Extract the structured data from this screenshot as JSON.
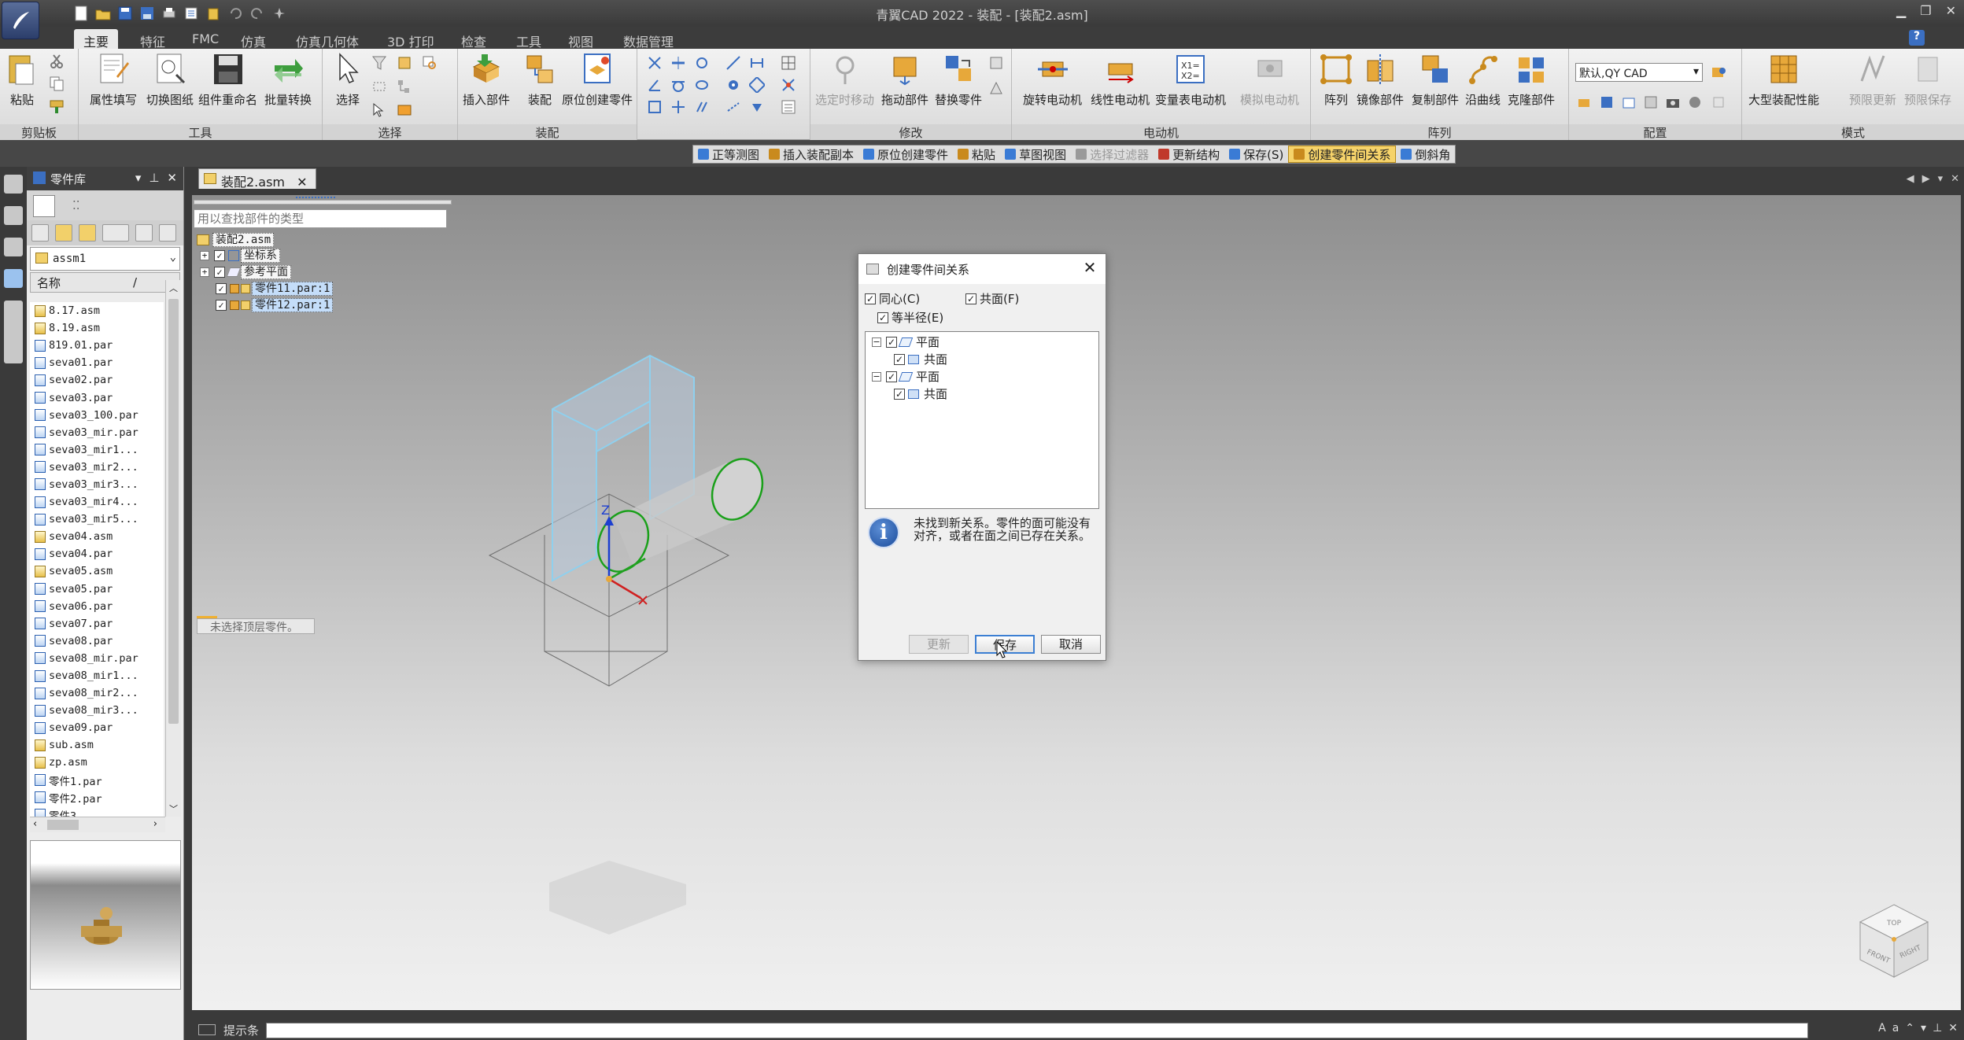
{
  "window": {
    "title": "青翼CAD 2022 - 装配 - [装配2.asm]",
    "help": "?"
  },
  "ribbon_tabs": [
    "主要",
    "特征",
    "FMC",
    "仿真",
    "仿真几何体",
    "3D 打印",
    "检查",
    "工具",
    "视图",
    "数据管理"
  ],
  "ribbon": {
    "clipboard": {
      "label": "剪贴板",
      "paste": "粘贴"
    },
    "tools": {
      "label": "工具",
      "prop_fill": "属性填写",
      "switch_drawing": "切换图纸",
      "rename": "组件重命名",
      "batch_convert": "批量转换"
    },
    "select": {
      "label": "选择",
      "select": "选择"
    },
    "assemble": {
      "label": "装配",
      "insert_part": "插入部件",
      "assemble": "装配",
      "create_in_place": "原位创建零件"
    },
    "modify": {
      "label": "修改",
      "move_selected": "选定时移动",
      "drag_part": "拖动部件",
      "replace_part": "替换零件"
    },
    "motor": {
      "label": "电动机",
      "rotary": "旋转电动机",
      "linear": "线性电动机",
      "table_motor": "变量表电动机",
      "simulate": "模拟电动机"
    },
    "pattern": {
      "label": "阵列",
      "pattern": "阵列",
      "mirror": "镜像部件",
      "copy": "复制部件",
      "along_curve": "沿曲线",
      "clone": "克隆部件"
    },
    "config": {
      "label": "配置",
      "config_value": "默认,QY CAD"
    },
    "mode": {
      "label": "模式",
      "large_asm": "大型装配性能",
      "preview_update": "预限更新",
      "preview_save": "预限保存"
    }
  },
  "command_bar": [
    {
      "label": "正等测图",
      "state": "normal",
      "icon_color": "#3a7bd5"
    },
    {
      "label": "插入装配副本",
      "state": "normal",
      "icon_color": "#c98a1d"
    },
    {
      "label": "原位创建零件",
      "state": "normal",
      "icon_color": "#3a7bd5"
    },
    {
      "label": "粘贴",
      "state": "normal",
      "icon_color": "#c98a1d"
    },
    {
      "label": "草图视图",
      "state": "normal",
      "icon_color": "#3a7bd5"
    },
    {
      "label": "选择过滤器",
      "state": "disabled",
      "icon_color": "#9a9a9a"
    },
    {
      "label": "更新结构",
      "state": "normal",
      "icon_color": "#c0392b"
    },
    {
      "label": "保存(S)",
      "state": "normal",
      "icon_color": "#3a7bd5"
    },
    {
      "label": "创建零件间关系",
      "state": "selected",
      "icon_color": "#c98a1d"
    },
    {
      "label": "倒斜角",
      "state": "normal",
      "icon_color": "#3a7bd5"
    }
  ],
  "part_library": {
    "title": "零件库",
    "folder": "assm1",
    "column_name": "名称",
    "column_sep": "/",
    "files": [
      {
        "name": "8.17.asm",
        "type": "asm"
      },
      {
        "name": "8.19.asm",
        "type": "asm"
      },
      {
        "name": "819.01.par",
        "type": "par"
      },
      {
        "name": "seva01.par",
        "type": "par"
      },
      {
        "name": "seva02.par",
        "type": "par"
      },
      {
        "name": "seva03.par",
        "type": "par"
      },
      {
        "name": "seva03_100.par",
        "type": "par"
      },
      {
        "name": "seva03_mir.par",
        "type": "par"
      },
      {
        "name": "seva03_mir1...",
        "type": "par"
      },
      {
        "name": "seva03_mir2...",
        "type": "par"
      },
      {
        "name": "seva03_mir3...",
        "type": "par"
      },
      {
        "name": "seva03_mir4...",
        "type": "par"
      },
      {
        "name": "seva03_mir5...",
        "type": "par"
      },
      {
        "name": "seva04.asm",
        "type": "asm"
      },
      {
        "name": "seva04.par",
        "type": "par"
      },
      {
        "name": "seva05.asm",
        "type": "asm"
      },
      {
        "name": "seva05.par",
        "type": "par"
      },
      {
        "name": "seva06.par",
        "type": "par"
      },
      {
        "name": "seva07.par",
        "type": "par"
      },
      {
        "name": "seva08.par",
        "type": "par"
      },
      {
        "name": "seva08_mir.par",
        "type": "par"
      },
      {
        "name": "seva08_mir1...",
        "type": "par"
      },
      {
        "name": "seva08_mir2...",
        "type": "par"
      },
      {
        "name": "seva08_mir3...",
        "type": "par"
      },
      {
        "name": "seva09.par",
        "type": "par"
      },
      {
        "name": "sub.asm",
        "type": "asm"
      },
      {
        "name": "zp.asm",
        "type": "asm"
      },
      {
        "name": "零件1.par",
        "type": "par"
      },
      {
        "name": "零件2.par",
        "type": "par"
      },
      {
        "name": "零件3",
        "type": "par"
      }
    ]
  },
  "document_tab": "装配2.asm",
  "pathfinder": {
    "search_placeholder": "用以查找部件的类型",
    "root": "装配2.asm",
    "nodes": [
      "坐标系",
      "参考平面",
      "零件11.par:1",
      "零件12.par:1"
    ],
    "hint": "未选择顶层零件。"
  },
  "dialog": {
    "title": "创建零件间关系",
    "concentric": "同心(C)",
    "coplanar": "共面(F)",
    "equal_radius": "等半径(E)",
    "tree": [
      {
        "label": "平面",
        "child": "共面"
      },
      {
        "label": "平面",
        "child": "共面"
      }
    ],
    "info": "未找到新关系。零件的面可能没有对齐，或者在面之间已存在关系。",
    "update": "更新",
    "save": "保存",
    "cancel": "取消"
  },
  "status_bar": {
    "label": "提示条"
  },
  "viewcube": {
    "top": "TOP",
    "front": "FRONT",
    "right": "RIGHT"
  },
  "axes": {
    "z": "Z"
  },
  "colors": {
    "accent": "#f6d36a",
    "part_edge": "#8fd0ee",
    "cylinder_edge": "#1aa01a"
  }
}
